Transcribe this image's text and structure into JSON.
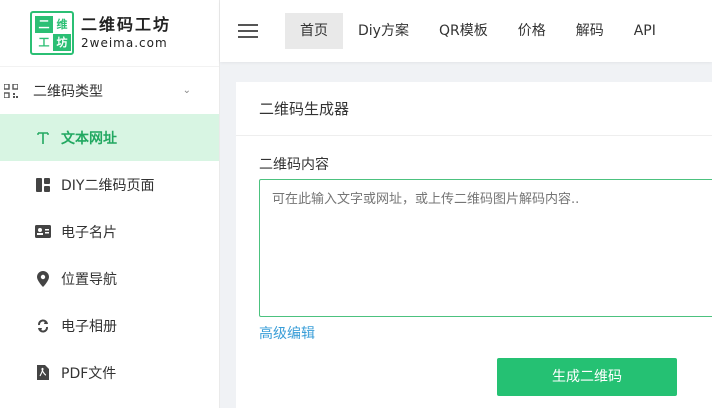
{
  "logo": {
    "title": "二维码工坊",
    "domain": "2weima.com",
    "mark_cells": [
      "二",
      "维",
      "工",
      "坊"
    ]
  },
  "sidebar": {
    "group": {
      "label": "二维码类型",
      "icon": "qr-grid-icon",
      "expanded": true
    },
    "items": [
      {
        "label": "文本网址",
        "icon": "text-t-icon",
        "active": true
      },
      {
        "label": "DIY二维码页面",
        "icon": "layout-icon",
        "active": false
      },
      {
        "label": "电子名片",
        "icon": "id-card-icon",
        "active": false
      },
      {
        "label": "位置导航",
        "icon": "location-pin-icon",
        "active": false
      },
      {
        "label": "电子相册",
        "icon": "album-icon",
        "active": false
      },
      {
        "label": "PDF文件",
        "icon": "pdf-file-icon",
        "active": false
      }
    ]
  },
  "topnav": {
    "items": [
      {
        "label": "首页",
        "active": true
      },
      {
        "label": "Diy方案",
        "active": false
      },
      {
        "label": "QR模板",
        "active": false
      },
      {
        "label": "价格",
        "active": false
      },
      {
        "label": "解码",
        "active": false
      },
      {
        "label": "API",
        "active": false
      }
    ]
  },
  "main": {
    "title": "二维码生成器",
    "field_label": "二维码内容",
    "placeholder": "可在此输入文字或网址，或上传二维码图片解码内容..",
    "advanced_link": "高级编辑",
    "generate_button": "生成二维码"
  },
  "colors": {
    "accent": "#25c173",
    "active_bg": "#d8f5e3",
    "link": "#3a9ed8"
  }
}
